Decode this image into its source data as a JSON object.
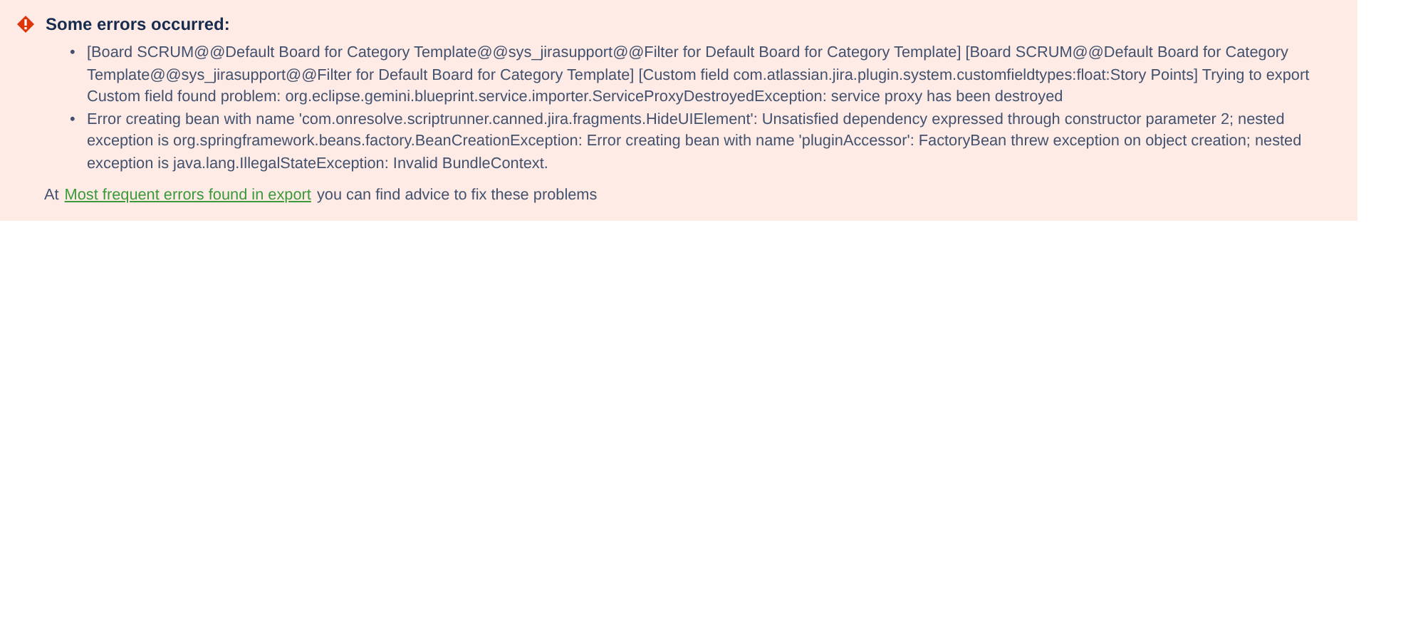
{
  "message": {
    "title": "Some errors occurred:",
    "errors": [
      {
        "bullet": "•",
        "text": "[Board SCRUM@@Default Board for Category Template@@sys_jirasupport@@Filter for Default Board for Category Template] [Board SCRUM@@Default Board for Category Template@@sys_jirasupport@@Filter for Default Board for Category Template] [Custom field com.atlassian.jira.plugin.system.customfieldtypes:float:Story Points]  Trying to export Custom field found problem: org.eclipse.gemini.blueprint.service.importer.ServiceProxyDestroyedException: service proxy has been destroyed"
      },
      {
        "bullet": "•",
        "text": "Error creating bean with name 'com.onresolve.scriptrunner.canned.jira.fragments.HideUIElement': Unsatisfied dependency expressed through constructor parameter 2; nested exception is org.springframework.beans.factory.BeanCreationException: Error creating bean with name 'pluginAccessor': FactoryBean threw exception on object creation; nested exception is java.lang.IllegalStateException: Invalid BundleContext."
      }
    ],
    "advice": {
      "before": "At",
      "link": "Most frequent errors found in export",
      "after": "you can find advice to fix these problems"
    }
  }
}
